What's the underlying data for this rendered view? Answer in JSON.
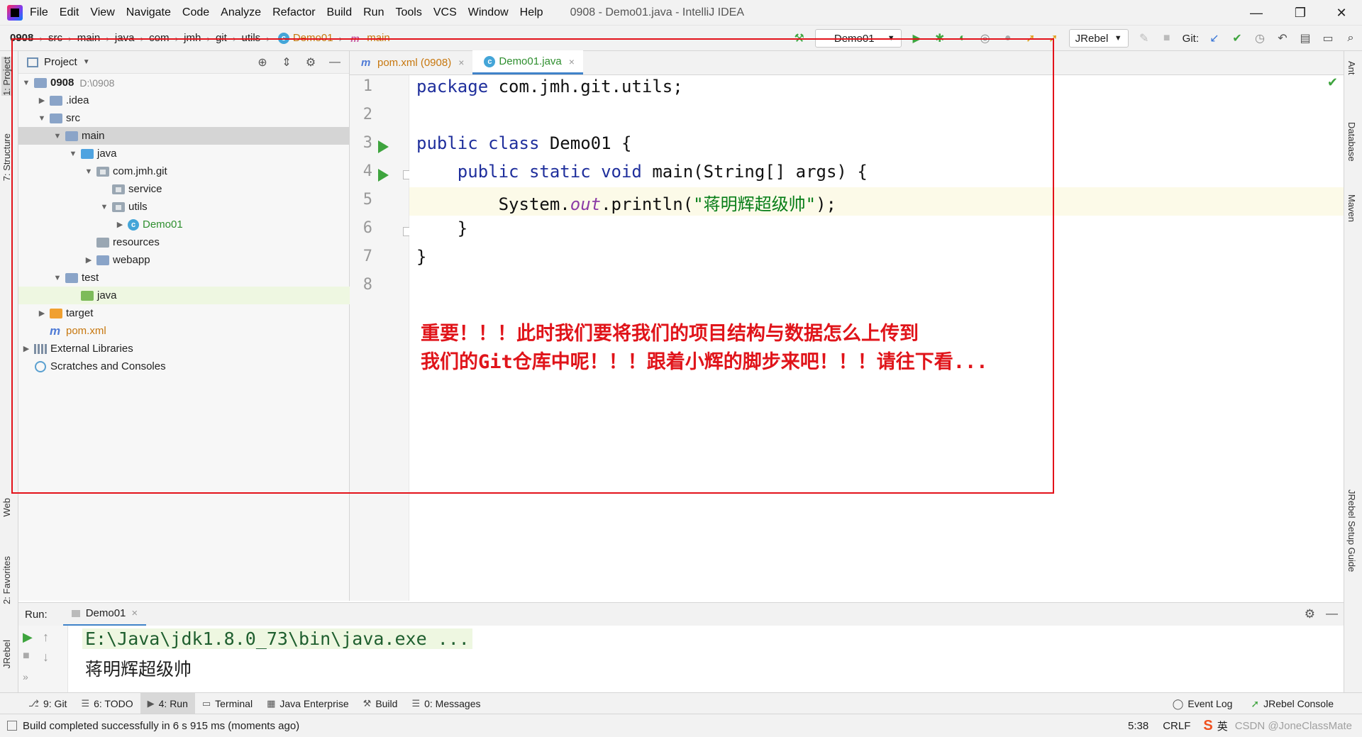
{
  "menubar": {
    "items": [
      "File",
      "Edit",
      "View",
      "Navigate",
      "Code",
      "Analyze",
      "Refactor",
      "Build",
      "Run",
      "Tools",
      "VCS",
      "Window",
      "Help"
    ],
    "window_title": "0908 - Demo01.java - IntelliJ IDEA",
    "minimize": "—",
    "restore": "❐",
    "close": "✕"
  },
  "breadcrumbs": [
    "0908",
    "src",
    "main",
    "java",
    "com",
    "jmh",
    "git",
    "utils",
    "Demo01",
    "main"
  ],
  "toolbar": {
    "run_config": "Demo01",
    "jrebel": "JRebel",
    "git_label": "Git:"
  },
  "project_panel": {
    "title": "Project",
    "tree": [
      {
        "label": "0908",
        "hint": "D:\\0908",
        "depth": 0,
        "arrow": "▼",
        "icon": "folder"
      },
      {
        "label": ".idea",
        "depth": 1,
        "arrow": "▶",
        "icon": "folder"
      },
      {
        "label": "src",
        "depth": 1,
        "arrow": "▼",
        "icon": "folder"
      },
      {
        "label": "main",
        "depth": 2,
        "arrow": "▼",
        "icon": "folder"
      },
      {
        "label": "java",
        "depth": 3,
        "arrow": "▼",
        "icon": "folder-blue"
      },
      {
        "label": "com.jmh.git",
        "depth": 4,
        "arrow": "▼",
        "icon": "package"
      },
      {
        "label": "service",
        "depth": 5,
        "arrow": "",
        "icon": "package"
      },
      {
        "label": "utils",
        "depth": 5,
        "arrow": "▼",
        "icon": "package"
      },
      {
        "label": "Demo01",
        "depth": 6,
        "arrow": "▶",
        "icon": "class"
      },
      {
        "label": "resources",
        "depth": 4,
        "arrow": "",
        "icon": "folder-gray"
      },
      {
        "label": "webapp",
        "depth": 4,
        "arrow": "▶",
        "icon": "folder"
      },
      {
        "label": "test",
        "depth": 2,
        "arrow": "▼",
        "icon": "folder"
      },
      {
        "label": "java",
        "depth": 3,
        "arrow": "",
        "icon": "folder-green"
      },
      {
        "label": "target",
        "depth": 1,
        "arrow": "▶",
        "icon": "folder-orange"
      },
      {
        "label": "pom.xml",
        "depth": 1,
        "arrow": "",
        "icon": "maven"
      },
      {
        "label": "External Libraries",
        "depth": 0,
        "arrow": "▶",
        "icon": "library"
      },
      {
        "label": "Scratches and Consoles",
        "depth": 0,
        "arrow": "",
        "icon": "scratch"
      }
    ]
  },
  "editor": {
    "tabs": [
      {
        "label": "pom.xml (0908)",
        "close": "×"
      },
      {
        "label": "Demo01.java",
        "close": "×"
      }
    ],
    "line_numbers": [
      "1",
      "2",
      "3",
      "4",
      "5",
      "6",
      "7",
      "8"
    ],
    "code": {
      "l1_kw": "package",
      "l1_rest": " com.jmh.git.utils;",
      "l3_kw": "public class",
      "l3_rest": " Demo01 {",
      "l4_indent": "    ",
      "l4_kw": "public static void",
      "l4_rest": " main(String[] args) {",
      "l5_a": "        System.",
      "l5_out": "out",
      "l5_b": ".println(",
      "l5_str": "\"蒋明辉超级帅\"",
      "l5_c": ");",
      "l6": "    }",
      "l7": "}"
    },
    "note_line1": "重要！！！此时我们要将我们的项目结构与数据怎么上传到",
    "note_line2": "我们的Git仓库中呢！！！跟着小辉的脚步来吧！！！请往下看...",
    "check": "✔"
  },
  "left_strip": [
    "1: Project",
    "7: Structure",
    "Web",
    "2: Favorites",
    "JRebel"
  ],
  "right_strip": [
    "Ant",
    "Database",
    "Maven",
    "JRebel Setup Guide"
  ],
  "run_panel": {
    "label": "Run:",
    "tab": "Demo01",
    "tab_close": "×",
    "cmd": "E:\\Java\\jdk1.8.0_73\\bin\\java.exe ...",
    "output": "蒋明辉超级帅"
  },
  "bottom_tools": [
    {
      "label": "9: Git",
      "icon": "⎇"
    },
    {
      "label": "6: TODO",
      "icon": "☰"
    },
    {
      "label": "4: Run",
      "icon": "▶"
    },
    {
      "label": "Terminal",
      "icon": "▭"
    },
    {
      "label": "Java Enterprise",
      "icon": "▦"
    },
    {
      "label": "Build",
      "icon": "⚒"
    },
    {
      "label": "0: Messages",
      "icon": "☰"
    }
  ],
  "bottom_right_tools": [
    "Event Log",
    "JRebel Console"
  ],
  "status": {
    "message": "Build completed successfully in 6 s 915 ms (moments ago)",
    "position": "5:38",
    "line_sep": "CRLF",
    "ime": "英",
    "watermark": "CSDN @JoneClassMate"
  },
  "colors": {
    "accent": "#4083c9",
    "annotation_red": "#e3121a",
    "run_green": "#3ea43e"
  }
}
